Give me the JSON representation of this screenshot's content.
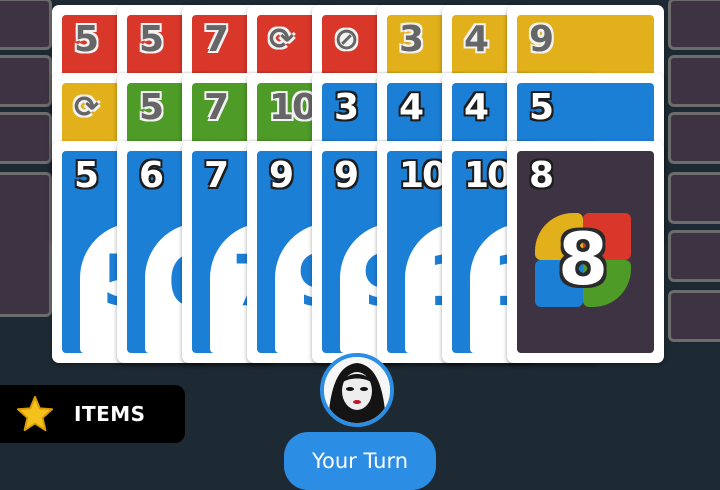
{
  "colors": {
    "red": "#d9372a",
    "yellow": "#e2b01a",
    "green": "#4e9b27",
    "blue": "#1c7fd6",
    "wild_bg": "#3d3342",
    "player_blue": "#2b8de3"
  },
  "hand": {
    "back_row": [
      {
        "label": "5",
        "color": "red"
      },
      {
        "label": "5",
        "color": "red"
      },
      {
        "label": "7",
        "color": "red"
      },
      {
        "label": "⟳",
        "color": "red",
        "icon": "reverse-icon"
      },
      {
        "label": "⊘",
        "color": "red",
        "icon": "skip-icon"
      },
      {
        "label": "3",
        "color": "yellow"
      },
      {
        "label": "4",
        "color": "yellow"
      },
      {
        "label": "9",
        "color": "yellow"
      }
    ],
    "middle_row": [
      {
        "label": "⟳",
        "color": "yellow",
        "icon": "reverse-icon"
      },
      {
        "label": "5",
        "color": "green"
      },
      {
        "label": "7",
        "color": "green"
      },
      {
        "label": "10",
        "color": "green"
      },
      {
        "label": "3",
        "color": "blue"
      },
      {
        "label": "4",
        "color": "blue"
      },
      {
        "label": "4",
        "color": "blue"
      },
      {
        "label": "5",
        "color": "blue"
      }
    ],
    "front_row": [
      {
        "label": "5",
        "color": "blue",
        "big": "5"
      },
      {
        "label": "6",
        "color": "blue",
        "big": "6"
      },
      {
        "label": "7",
        "color": "blue",
        "big": "7"
      },
      {
        "label": "9",
        "color": "blue",
        "big": "9"
      },
      {
        "label": "9",
        "color": "blue",
        "big": "9"
      },
      {
        "label": "10",
        "color": "blue",
        "big": "1"
      },
      {
        "label": "10",
        "color": "blue",
        "big": "1"
      },
      {
        "label": "8",
        "color": "wild",
        "big": "8"
      }
    ]
  },
  "items": {
    "label": "ITEMS",
    "icon": "star-icon"
  },
  "player": {
    "turn_label": "Your Turn",
    "avatar_icon": "player-avatar"
  }
}
